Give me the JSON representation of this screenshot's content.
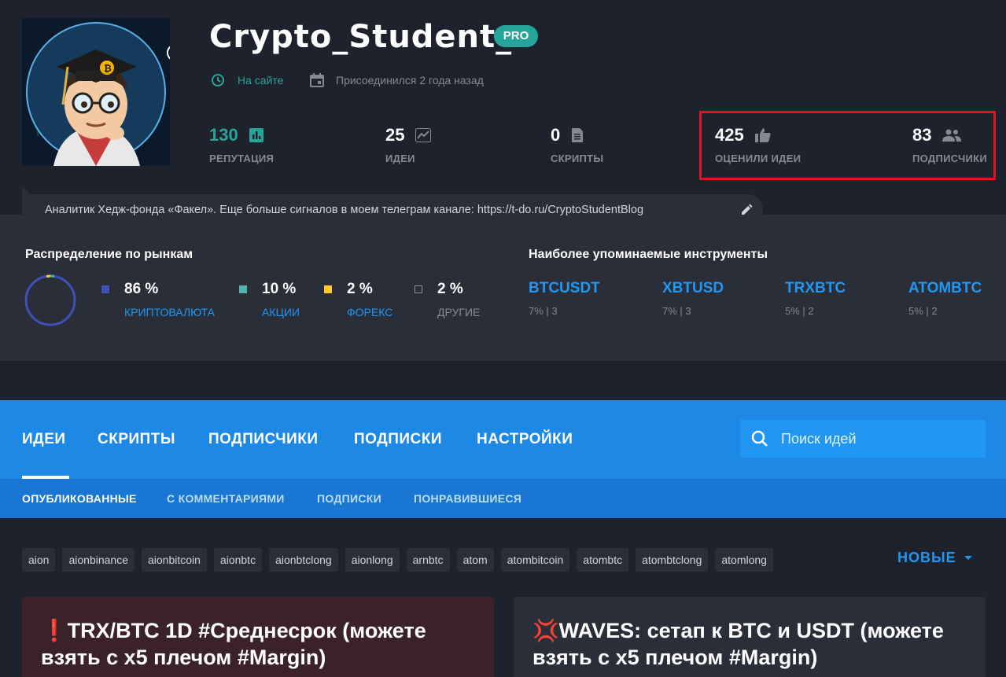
{
  "profile": {
    "username": "Crypto_Student_",
    "badge": "PRO",
    "status_online": "На сайте",
    "joined": "Присоединился 2 года назад",
    "bio": "Аналитик Хедж-фонда «Факел». Еще больше сигналов в моем телеграм канале: https://t-do.ru/CryptoStudentBlog",
    "stats": {
      "reputation": {
        "value": "130",
        "label": "РЕПУТАЦИЯ"
      },
      "ideas": {
        "value": "25",
        "label": "ИДЕИ"
      },
      "scripts": {
        "value": "0",
        "label": "СКРИПТЫ"
      },
      "likes": {
        "value": "425",
        "label": "ОЦЕНИЛИ ИДЕИ"
      },
      "followers": {
        "value": "83",
        "label": "ПОДПИСЧИКИ"
      }
    }
  },
  "markets": {
    "title": "Распределение по рынкам",
    "items": [
      {
        "pct": "86 %",
        "name": "КРИПТОВАЛЮТА",
        "color": "#3f51b5"
      },
      {
        "pct": "10 %",
        "name": "АКЦИИ",
        "color": "#4db6ac"
      },
      {
        "pct": "2 %",
        "name": "ФОРЕКС",
        "color": "#ffca28"
      },
      {
        "pct": "2 %",
        "name": "ДРУГИЕ",
        "color": "#2a2e39"
      }
    ]
  },
  "instruments": {
    "title": "Наиболее упоминаемые инструменты",
    "items": [
      {
        "symbol": "BTCUSDT",
        "meta": "7% | 3"
      },
      {
        "symbol": "XBTUSD",
        "meta": "7% | 3"
      },
      {
        "symbol": "TRXBTC",
        "meta": "5% | 2"
      },
      {
        "symbol": "ATOMBTC",
        "meta": "5% | 2"
      }
    ]
  },
  "tabs": [
    {
      "label": "ИДЕИ"
    },
    {
      "label": "СКРИПТЫ"
    },
    {
      "label": "ПОДПИСЧИКИ"
    },
    {
      "label": "ПОДПИСКИ"
    },
    {
      "label": "НАСТРОЙКИ"
    }
  ],
  "search": {
    "placeholder": "Поиск идей"
  },
  "subtabs": [
    {
      "label": "ОПУБЛИКОВАННЫЕ"
    },
    {
      "label": "С КОММЕНТАРИЯМИ"
    },
    {
      "label": "ПОДПИСКИ"
    },
    {
      "label": "ПОНРАВИВШИЕСЯ"
    }
  ],
  "tags": [
    "aion",
    "aionbinance",
    "aionbitcoin",
    "aionbtc",
    "aionbtclong",
    "aionlong",
    "arnbtc",
    "atom",
    "atombitcoin",
    "atombtc",
    "atombtclong",
    "atomlong"
  ],
  "sort_label": "НОВЫЕ",
  "cards": [
    {
      "emoji": "❗",
      "title": "TRX/BTC 1D #Среднесрок (можете взять с х5 плечом #Margin)"
    },
    {
      "emoji": "💢",
      "title": "WAVES: сетап к BTC и USDT (можете взять с х5 плечом #Margin)"
    }
  ],
  "colors": {
    "accent": "#2196f3",
    "tab_bar": "#1e88e5",
    "green": "#26a69a",
    "highlight": "#e0141e"
  }
}
